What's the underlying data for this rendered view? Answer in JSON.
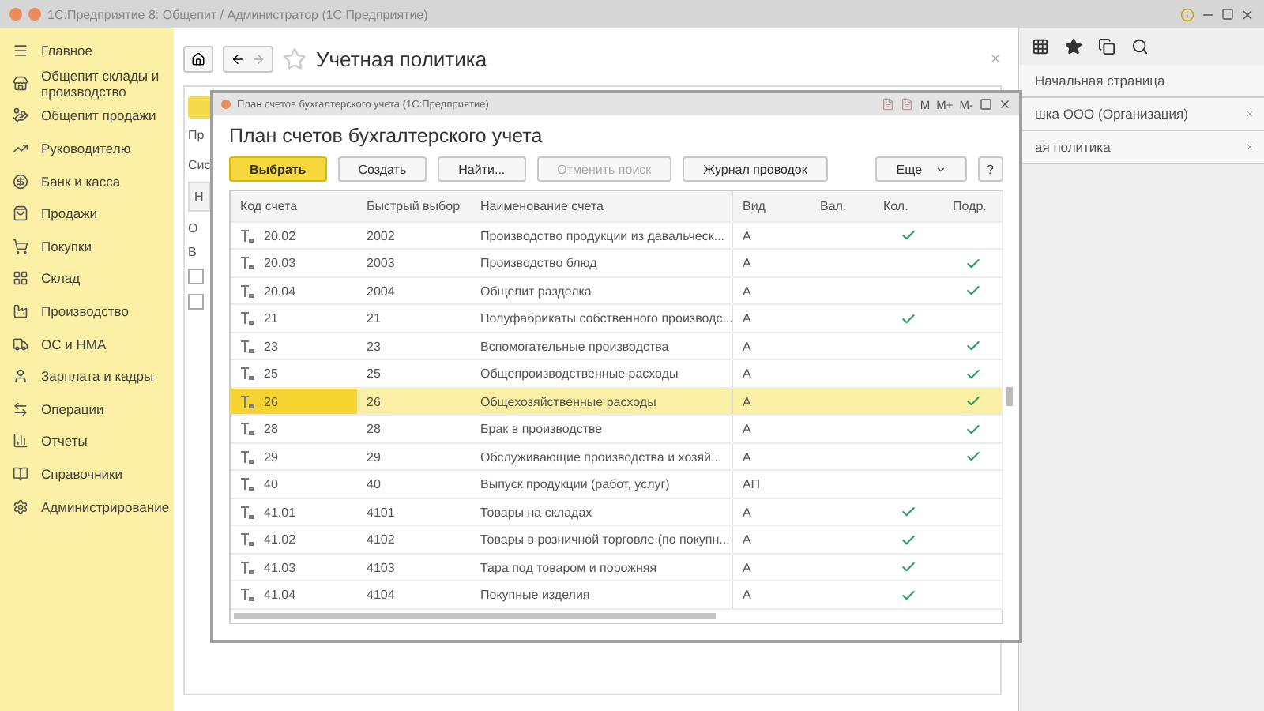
{
  "window": {
    "title": "1С:Предприятие 8: Общепит / Администратор  (1С:Предприятие)"
  },
  "sidebar": {
    "items": [
      {
        "label": "Главное"
      },
      {
        "label": "Общепит склады и производство"
      },
      {
        "label": "Общепит продажи"
      },
      {
        "label": "Руководителю"
      },
      {
        "label": "Банк и касса"
      },
      {
        "label": "Продажи"
      },
      {
        "label": "Покупки"
      },
      {
        "label": "Склад"
      },
      {
        "label": "Производство"
      },
      {
        "label": "ОС и НМА"
      },
      {
        "label": "Зарплата и кадры"
      },
      {
        "label": "Операции"
      },
      {
        "label": "Отчеты"
      },
      {
        "label": "Справочники"
      },
      {
        "label": "Администрирование"
      }
    ]
  },
  "page": {
    "title": "Учетная политика",
    "fragments": [
      "Пр",
      "Сис",
      "Н",
      "О",
      "В"
    ],
    "checkboxes": [
      {
        "checked": false
      },
      {
        "checked": false
      }
    ]
  },
  "right_panel": {
    "items": [
      "Начальная страница",
      "шка ООО (Организация)",
      "ая политика"
    ]
  },
  "dialog": {
    "window_title": "План счетов бухгалтерского учета  (1С:Предприятие)",
    "memory_buttons": [
      "M",
      "M+",
      "M-"
    ],
    "heading": "План счетов бухгалтерского учета",
    "buttons": [
      {
        "label": "Выбрать",
        "kind": "primary",
        "disabled": false
      },
      {
        "label": "Создать",
        "kind": "normal",
        "disabled": false
      },
      {
        "label": "Найти...",
        "kind": "normal",
        "disabled": false
      },
      {
        "label": "Отменить поиск",
        "kind": "normal",
        "disabled": true
      },
      {
        "label": "Журнал проводок",
        "kind": "normal",
        "disabled": false
      }
    ],
    "more_button": "Еще",
    "help_button": "?",
    "table": {
      "columns": [
        "Код счета",
        "Быстрый выбор",
        "Наименование счета",
        "Вид",
        "Вал.",
        "Кол.",
        "Подр."
      ],
      "rows": [
        {
          "code": "20.02",
          "quick": "2002",
          "name": "Производство продукции из давальческ...",
          "type": "А",
          "qty": true,
          "sub": false,
          "selected": false
        },
        {
          "code": "20.03",
          "quick": "2003",
          "name": "Производство блюд",
          "type": "А",
          "qty": false,
          "sub": true,
          "selected": false
        },
        {
          "code": "20.04",
          "quick": "2004",
          "name": "Общепит разделка",
          "type": "А",
          "qty": false,
          "sub": true,
          "selected": false
        },
        {
          "code": "21",
          "quick": "21",
          "name": "Полуфабрикаты собственного производс...",
          "type": "А",
          "qty": true,
          "sub": false,
          "selected": false
        },
        {
          "code": "23",
          "quick": "23",
          "name": "Вспомогательные производства",
          "type": "А",
          "qty": false,
          "sub": true,
          "selected": false
        },
        {
          "code": "25",
          "quick": "25",
          "name": "Общепроизводственные расходы",
          "type": "А",
          "qty": false,
          "sub": true,
          "selected": false
        },
        {
          "code": "26",
          "quick": "26",
          "name": "Общехозяйственные расходы",
          "type": "А",
          "qty": false,
          "sub": true,
          "selected": true
        },
        {
          "code": "28",
          "quick": "28",
          "name": "Брак в производстве",
          "type": "А",
          "qty": false,
          "sub": true,
          "selected": false
        },
        {
          "code": "29",
          "quick": "29",
          "name": "Обслуживающие производства и хозяй...",
          "type": "А",
          "qty": false,
          "sub": true,
          "selected": false
        },
        {
          "code": "40",
          "quick": "40",
          "name": "Выпуск продукции (работ, услуг)",
          "type": "АП",
          "qty": false,
          "sub": false,
          "selected": false
        },
        {
          "code": "41.01",
          "quick": "4101",
          "name": "Товары на складах",
          "type": "А",
          "qty": true,
          "sub": false,
          "selected": false
        },
        {
          "code": "41.02",
          "quick": "4102",
          "name": "Товары в розничной торговле (по покупн...",
          "type": "А",
          "qty": true,
          "sub": false,
          "selected": false
        },
        {
          "code": "41.03",
          "quick": "4103",
          "name": "Тара под товаром и порожняя",
          "type": "А",
          "qty": true,
          "sub": false,
          "selected": false
        },
        {
          "code": "41.04",
          "quick": "4104",
          "name": "Покупные изделия",
          "type": "А",
          "qty": true,
          "sub": false,
          "selected": false
        }
      ]
    }
  }
}
